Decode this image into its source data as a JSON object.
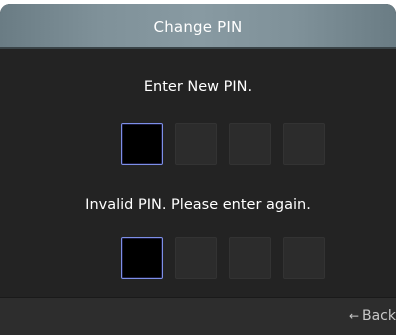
{
  "dialog": {
    "title": "Change PIN"
  },
  "pin_entry": {
    "prompt": "Enter New PIN.",
    "digits": [
      "",
      "",
      "",
      ""
    ],
    "active_index": 0
  },
  "pin_confirm": {
    "prompt": "Invalid PIN. Please enter again.",
    "digits": [
      "",
      "",
      "",
      ""
    ],
    "active_index": 0
  },
  "footer": {
    "back_label": "Back",
    "back_icon": "arrow-left-icon",
    "back_glyph": "←"
  },
  "colors": {
    "active_border": "#7d8fe8",
    "title_bar": "#7f9199",
    "background": "#232323"
  }
}
